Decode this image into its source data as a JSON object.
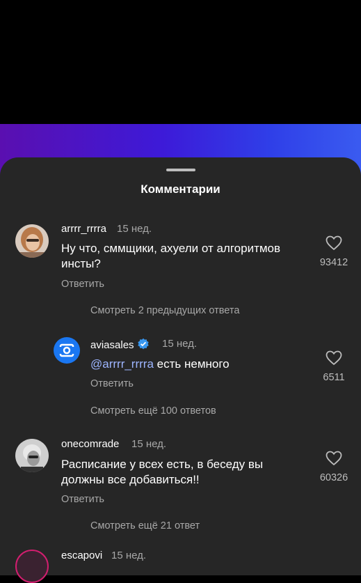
{
  "sheet": {
    "title": "Комментарии"
  },
  "comments": [
    {
      "username": "arrrr_rrrra",
      "time": "15 нед.",
      "text": "Ну что, сммщики, ахуели от алгоритмов инсты?",
      "reply_label": "Ответить",
      "likes": "93412",
      "view_replies": "Смотреть 2 предыдущих ответа"
    },
    {
      "username": "aviasales",
      "time": "15 нед.",
      "mention": "@arrrr_rrrra",
      "text": "есть немного",
      "reply_label": "Ответить",
      "likes": "6511",
      "verified_icon": "verified-badge-icon",
      "view_replies": "Смотреть ещё 100 ответов"
    },
    {
      "username": "onecomrade",
      "time": "15 нед.",
      "text": "Расписание у всех есть, в беседу вы должны все добавиться!!",
      "reply_label": "Ответить",
      "likes": "60326",
      "view_replies": "Смотреть ещё 21 ответ"
    },
    {
      "username": "escapovi",
      "time": "15 нед."
    }
  ],
  "colors": {
    "sheet_bg": "#262626",
    "accent_blue": "#3897f0",
    "mention": "#9db5ff",
    "secondary_text": "#a8a8a8"
  }
}
